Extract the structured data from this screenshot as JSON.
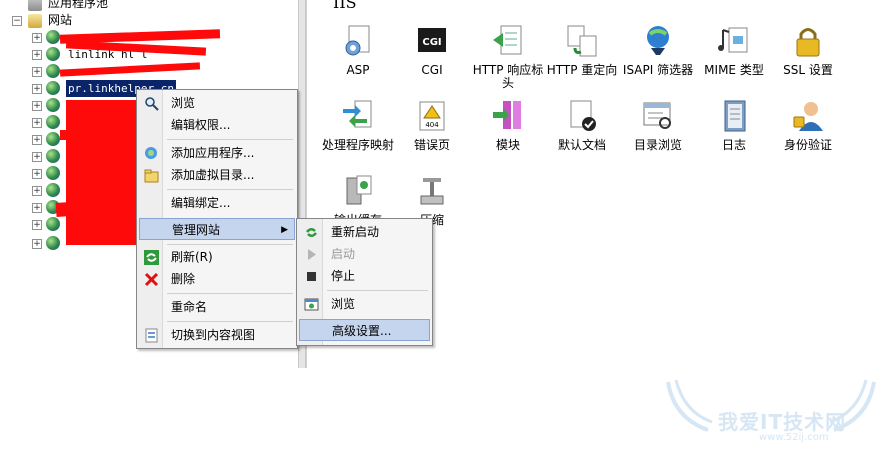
{
  "tree": {
    "app_pools_label": "应用程序池",
    "sites_label": "网站",
    "partial_site_label": "linlink hl l",
    "selected_site": "pr.linkhelper.cn"
  },
  "pane": {
    "title": "IIS",
    "features": [
      {
        "label": "ASP",
        "icon": "asp-icon"
      },
      {
        "label": "CGI",
        "icon": "cgi-icon"
      },
      {
        "label": "HTTP 响应标头",
        "icon": "http-response-headers-icon"
      },
      {
        "label": "HTTP 重定向",
        "icon": "http-redirect-icon"
      },
      {
        "label": "ISAPI 筛选器",
        "icon": "isapi-filters-icon"
      },
      {
        "label": "MIME 类型",
        "icon": "mime-types-icon"
      },
      {
        "label": "SSL 设置",
        "icon": "ssl-lock-icon"
      },
      {
        "label": "处理程序映射",
        "icon": "handler-mappings-icon"
      },
      {
        "label": "错误页",
        "icon": "error-pages-icon"
      },
      {
        "label": "模块",
        "icon": "modules-icon"
      },
      {
        "label": "默认文档",
        "icon": "default-document-icon"
      },
      {
        "label": "目录浏览",
        "icon": "directory-browsing-icon"
      },
      {
        "label": "日志",
        "icon": "logging-icon"
      },
      {
        "label": "身份验证",
        "icon": "authentication-icon"
      },
      {
        "label": "输出缓存",
        "icon": "output-caching-icon"
      },
      {
        "label": "压缩",
        "icon": "compression-icon"
      }
    ]
  },
  "context_menu": {
    "browse": "浏览",
    "edit_permissions": "编辑权限...",
    "add_application": "添加应用程序...",
    "add_virtual_dir": "添加虚拟目录...",
    "edit_bindings": "编辑绑定...",
    "manage_site": "管理网站",
    "refresh": "刷新(R)",
    "delete": "删除",
    "rename": "重命名",
    "switch_content_view": "切换到内容视图"
  },
  "submenu": {
    "restart": "重新启动",
    "start": "启动",
    "stop": "停止",
    "browse": "浏览",
    "advanced_settings": "高级设置..."
  },
  "watermark": {
    "text": "我爱IT技术网",
    "url": "www.52ij.com"
  },
  "colors": {
    "selection": "#0a246a",
    "menu_highlight": "#c6d5ee",
    "redaction": "#ff0a0a"
  }
}
